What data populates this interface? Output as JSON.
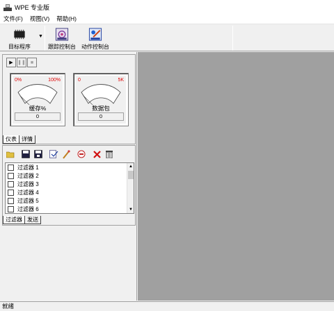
{
  "window": {
    "title": "WPE 专业版"
  },
  "menu": [
    {
      "label": "文件(F)"
    },
    {
      "label": "视图(V)"
    },
    {
      "label": "帮助(H)"
    }
  ],
  "toolbar": {
    "target_label": "目标程序",
    "trace_label": "跟踪控制台",
    "action_label": "动作控制台"
  },
  "gauges": [
    {
      "min": "0%",
      "max": "100%",
      "label": "缓存%",
      "value": "0",
      "fraction": 0
    },
    {
      "min": "0",
      "max": "5K",
      "label": "数据包",
      "value": "0",
      "fraction": 0
    }
  ],
  "gauge_tabs": [
    {
      "label": "仪表"
    },
    {
      "label": "详情"
    }
  ],
  "filters": [
    {
      "label": "过滤器 1",
      "checked": false
    },
    {
      "label": "过滤器 2",
      "checked": false
    },
    {
      "label": "过滤器 3",
      "checked": false
    },
    {
      "label": "过滤器 4",
      "checked": false
    },
    {
      "label": "过滤器 5",
      "checked": false
    },
    {
      "label": "过滤器 6",
      "checked": false
    }
  ],
  "filter_tabs": [
    {
      "label": "过滤器"
    },
    {
      "label": "发送"
    }
  ],
  "status": {
    "text": "就绪"
  },
  "colors": {
    "gauge_scale": "#e00000",
    "workspace": "#a0a0a0"
  }
}
